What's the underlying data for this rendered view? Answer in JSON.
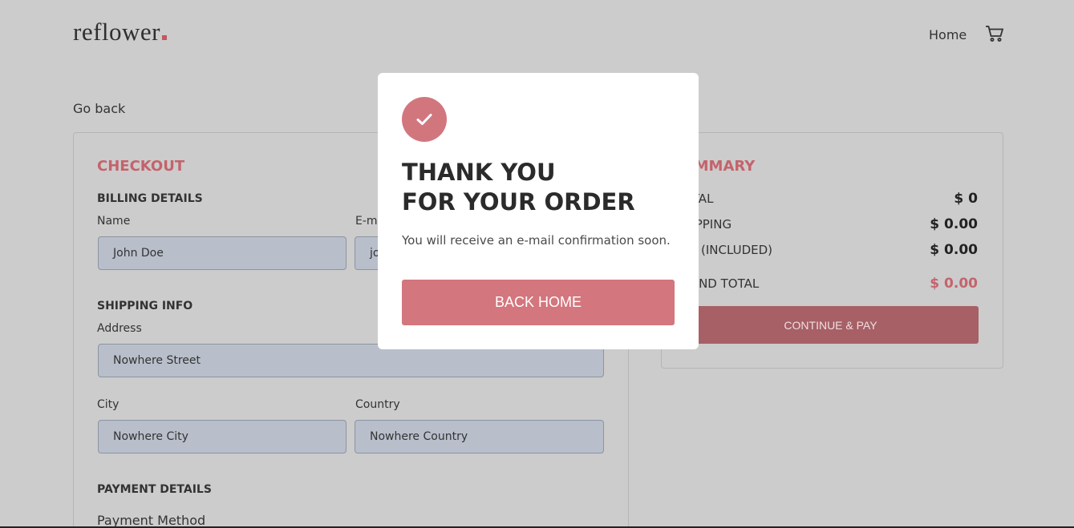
{
  "header": {
    "brand": "reflower",
    "nav_home": "Home",
    "cart_icon": "cart-icon"
  },
  "go_back": "Go back",
  "checkout": {
    "title": "CHECKOUT",
    "billing": {
      "title": "BILLING DETAILS",
      "name_label": "Name",
      "name_value": "John Doe",
      "email_label": "E-mail",
      "email_value": "jo"
    },
    "shipping": {
      "title": "SHIPPING INFO",
      "address_label": "Address",
      "address_value": "Nowhere Street",
      "city_label": "City",
      "city_value": "Nowhere City",
      "country_label": "Country",
      "country_value": "Nowhere Country"
    },
    "payment": {
      "title": "PAYMENT DETAILS",
      "method_label": "Payment Method"
    }
  },
  "summary": {
    "title": "UMMARY",
    "total_label": "OTAL",
    "total_value": "$ 0",
    "shipping_label": "HIPPING",
    "shipping_value": "$ 0.00",
    "vat_label": "AT (INCLUDED)",
    "vat_value": "$ 0.00",
    "grand_label": "RAND TOTAL",
    "grand_value": "$ 0.00",
    "continue_label": "CONTINUE & PAY"
  },
  "modal": {
    "check_icon": "check-icon",
    "title_line1": "THANK YOU",
    "title_line2": "FOR YOUR ORDER",
    "text": "You will receive an e-mail confirmation soon.",
    "button": "BACK HOME"
  },
  "colors": {
    "accent": "#c4636c",
    "overlay": "#cccccc",
    "field_bg": "#b8bfcb",
    "button": "#d3767d"
  }
}
